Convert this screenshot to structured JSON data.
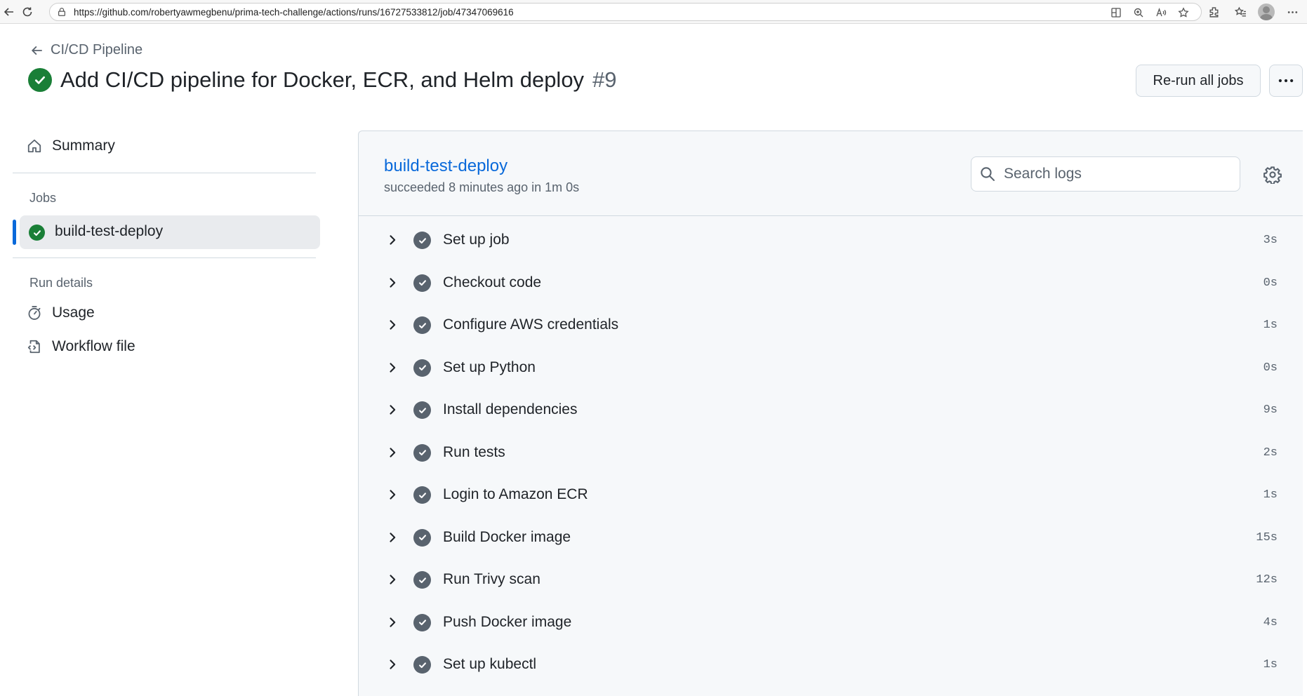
{
  "browser": {
    "url": "https://github.com/robertyawmegbenu/prima-tech-challenge/actions/runs/16727533812/job/47347069616"
  },
  "header": {
    "back_label": "CI/CD Pipeline",
    "title": "Add CI/CD pipeline for Docker, ECR, and Helm deploy",
    "run_number": "#9",
    "rerun_label": "Re-run all jobs"
  },
  "sidebar": {
    "summary_label": "Summary",
    "jobs_heading": "Jobs",
    "selected_job": "build-test-deploy",
    "run_details_heading": "Run details",
    "usage_label": "Usage",
    "workflow_file_label": "Workflow file"
  },
  "job": {
    "name": "build-test-deploy",
    "status": "succeeded 8 minutes ago in 1m 0s",
    "search_placeholder": "Search logs",
    "steps": [
      {
        "name": "Set up job",
        "duration": "3s"
      },
      {
        "name": "Checkout code",
        "duration": "0s"
      },
      {
        "name": "Configure AWS credentials",
        "duration": "1s"
      },
      {
        "name": "Set up Python",
        "duration": "0s"
      },
      {
        "name": "Install dependencies",
        "duration": "9s"
      },
      {
        "name": "Run tests",
        "duration": "2s"
      },
      {
        "name": "Login to Amazon ECR",
        "duration": "1s"
      },
      {
        "name": "Build Docker image",
        "duration": "15s"
      },
      {
        "name": "Run Trivy scan",
        "duration": "12s"
      },
      {
        "name": "Push Docker image",
        "duration": "4s"
      },
      {
        "name": "Set up kubectl",
        "duration": "1s"
      }
    ]
  },
  "colors": {
    "success": "#1a7f37",
    "link": "#0969da",
    "muted": "#59636e",
    "selected_bg": "#e9ebee",
    "panel_bg": "#f6f8fa"
  }
}
